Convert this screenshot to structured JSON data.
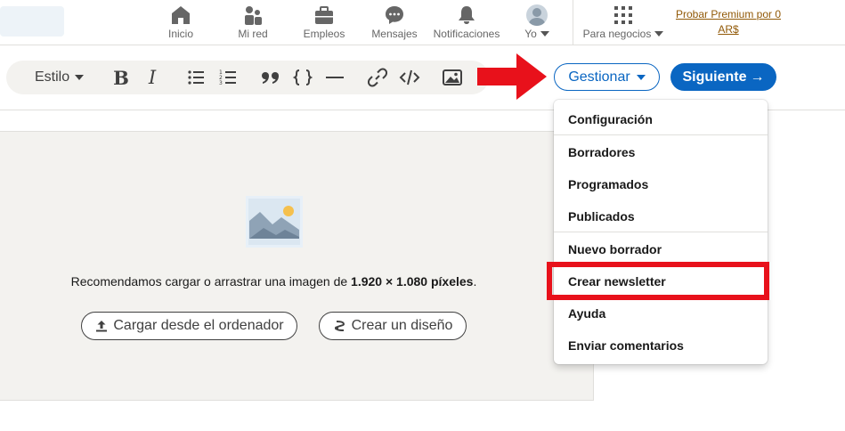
{
  "nav": {
    "items": [
      {
        "label": "Inicio",
        "icon": "home-icon"
      },
      {
        "label": "Mi red",
        "icon": "network-icon"
      },
      {
        "label": "Empleos",
        "icon": "briefcase-icon"
      },
      {
        "label": "Mensajes",
        "icon": "chat-icon"
      },
      {
        "label": "Notificaciones",
        "icon": "bell-icon"
      },
      {
        "label": "Yo",
        "icon": "avatar"
      }
    ],
    "business_label": "Para negocios",
    "premium_line1": "Probar Premium por 0",
    "premium_line2": "AR$"
  },
  "toolbar": {
    "style_label": "Estilo",
    "bold": "B",
    "italic": "I"
  },
  "actions": {
    "manage_label": "Gestionar",
    "next_label": "Siguiente",
    "next_arrow": "→"
  },
  "upload": {
    "text_prefix": "Recomendamos cargar o arrastrar una imagen de ",
    "text_bold": "1.920 × 1.080 píxeles",
    "text_suffix": ".",
    "upload_button": "Cargar desde el ordenador",
    "design_button": "Crear un diseño"
  },
  "dropdown": {
    "items": [
      "Configuración",
      "Borradores",
      "Programados",
      "Publicados",
      "Nuevo borrador",
      "Crear newsletter",
      "Ayuda",
      "Enviar comentarios"
    ]
  },
  "colors": {
    "brand_blue": "#0a66c2",
    "annotation_red": "#e8111b",
    "premium_gold": "#915907"
  }
}
